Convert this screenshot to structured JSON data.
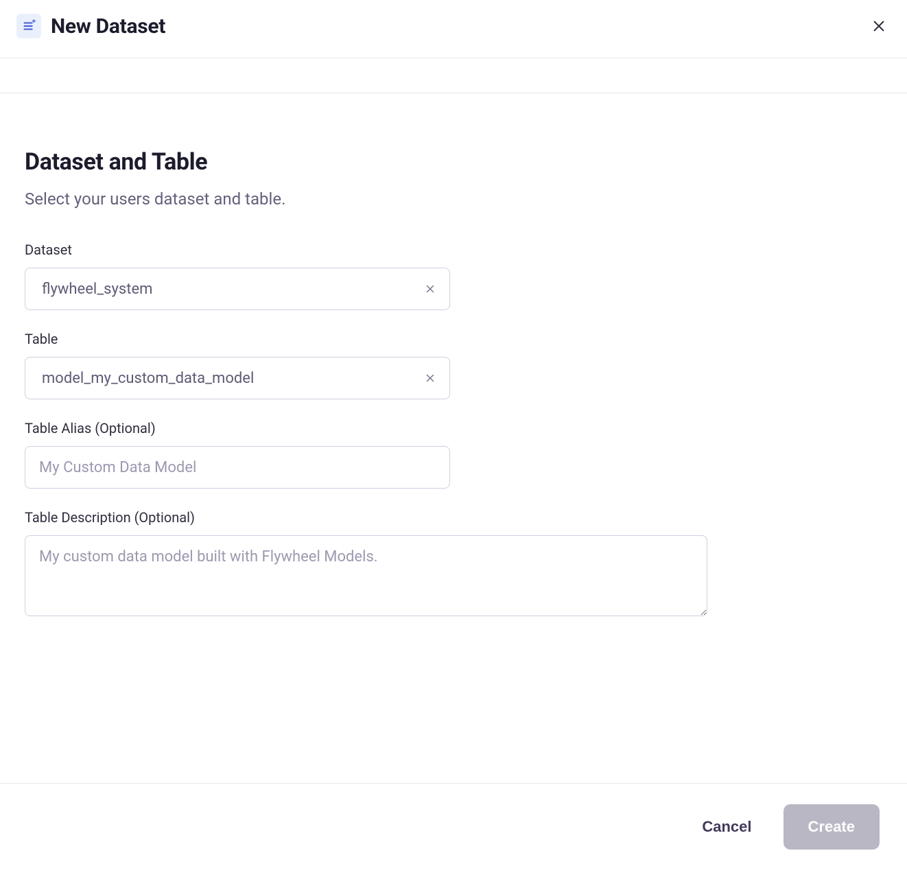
{
  "header": {
    "title": "New Dataset"
  },
  "section": {
    "title": "Dataset and Table",
    "subtitle": "Select your users dataset and table."
  },
  "form": {
    "dataset": {
      "label": "Dataset",
      "value": "flywheel_system"
    },
    "table": {
      "label": "Table",
      "value": "model_my_custom_data_model"
    },
    "alias": {
      "label": "Table Alias (Optional)",
      "placeholder": "My Custom Data Model",
      "value": ""
    },
    "description": {
      "label": "Table Description (Optional)",
      "placeholder": "My custom data model built with Flywheel Models.",
      "value": ""
    }
  },
  "footer": {
    "cancel": "Cancel",
    "create": "Create"
  }
}
